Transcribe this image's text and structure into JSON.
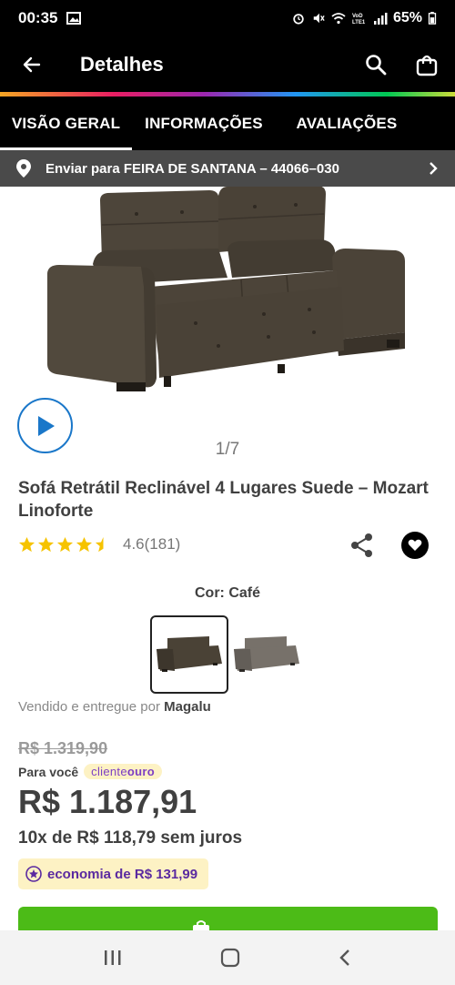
{
  "status": {
    "time": "00:35",
    "battery": "65%",
    "icons": [
      "image-icon",
      "alarm-icon",
      "mute-icon",
      "wifi-icon",
      "volte-icon",
      "signal-icon",
      "battery-icon"
    ]
  },
  "header": {
    "title": "Detalhes",
    "icons": [
      "back-arrow-icon",
      "search-icon",
      "shopping-bag-icon"
    ]
  },
  "tabs": [
    {
      "label": "VISÃO GERAL",
      "active": true
    },
    {
      "label": "INFORMAÇÕES",
      "active": false
    },
    {
      "label": "AVALIAÇÕES",
      "active": false
    }
  ],
  "delivery": {
    "text": "Enviar para FEIRA DE SANTANA – 44066–030"
  },
  "gallery": {
    "counter": "1/7"
  },
  "product": {
    "title": "Sofá Retrátil Reclinável 4 Lugares Suede – Mozart Linoforte",
    "rating": "4.6",
    "rating_count": "(181)",
    "stars": 4.5,
    "color_label": "Cor:",
    "color_value": "Café",
    "seller_prefix": "Vendido e entregue por",
    "seller_name": "Magalu"
  },
  "pricing": {
    "old_price": "R$ 1.319,90",
    "para_voce": "Para você",
    "badge_cliente": "cliente",
    "badge_ouro": "ouro",
    "price": "R$ 1.187,91",
    "installments": "10x de R$ 118,79 sem juros",
    "savings": "economia de R$ 131,99"
  },
  "colors": {
    "accent_green": "#4cbb17",
    "sofa_cafe": "#4a4236",
    "sofa_gray": "#6f6a63",
    "play_blue": "#1a77c9",
    "star_yellow": "#f6c300",
    "savings_purple": "#5a2aa0"
  }
}
